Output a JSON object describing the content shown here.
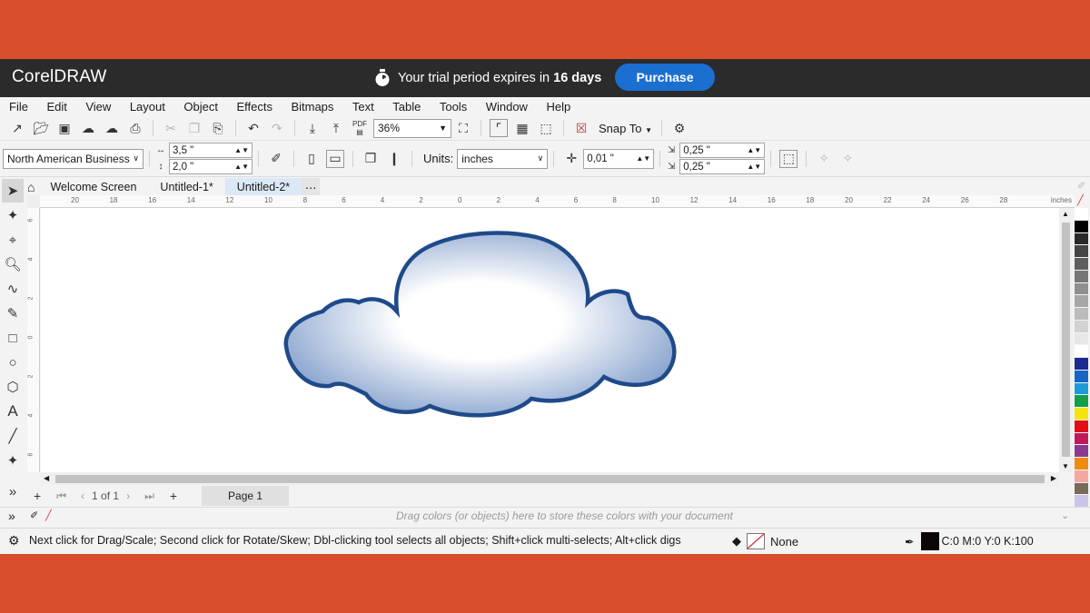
{
  "window": {
    "brand": "CorelDRAW",
    "trial_prefix": "Your trial period expires in ",
    "trial_days": "16 days",
    "purchase_label": "Purchase"
  },
  "menu": [
    "File",
    "Edit",
    "View",
    "Layout",
    "Object",
    "Effects",
    "Bitmaps",
    "Text",
    "Table",
    "Tools",
    "Window",
    "Help"
  ],
  "toolbar": {
    "zoom": "36%",
    "snap_label": "Snap To",
    "pdf_label": "PDF"
  },
  "property_bar": {
    "paper_size": "North American Business",
    "width": "3,5 \"",
    "height": "2,0 \"",
    "units_label": "Units:",
    "units_value": "inches",
    "nudge": "0,01 \"",
    "dup_x": "0,25 \"",
    "dup_y": "0,25 \""
  },
  "doc_tabs": [
    "Welcome Screen",
    "Untitled-1*",
    "Untitled-2*"
  ],
  "ruler": {
    "h_ticks": [
      "20",
      "18",
      "16",
      "14",
      "12",
      "10",
      "8",
      "6",
      "4",
      "2",
      "0",
      "2",
      "4",
      "6",
      "8",
      "10",
      "12",
      "14",
      "16",
      "18",
      "20",
      "22",
      "24",
      "26",
      "28"
    ],
    "unit": "inches",
    "v_ticks": [
      "6",
      "4",
      "2",
      "0",
      "2",
      "4",
      "6"
    ]
  },
  "page_nav": {
    "current": "1",
    "of_label": "of",
    "total": "1",
    "page_tab": "Page 1"
  },
  "docker_hint": "Drag colors (or objects) here to store these colors with your document",
  "status": {
    "message": "Next click for Drag/Scale; Second click for Rotate/Skew; Dbl-clicking tool selects all objects; Shift+click multi-selects; Alt+click digs",
    "fill_label": "None",
    "outline_value": "C:0 M:0 Y:0 K:100"
  },
  "colors": {
    "background": "#d94f2b",
    "titlebar": "#2b2b2b",
    "accent": "#1b6fd1",
    "cloud_outline": "#1f4a8a",
    "cloud_fill_light": "#ffffff",
    "cloud_fill_dark": "#7c9ac9"
  },
  "palette": [
    "#ffffff",
    "#000000",
    "#2a2a2a",
    "#454545",
    "#5e5e5e",
    "#777777",
    "#8f8f8f",
    "#a7a7a7",
    "#bcbcbc",
    "#d2d2d2",
    "#e7e7e7",
    "#ffffff",
    "#1c2b8f",
    "#1466c7",
    "#1c9bd6",
    "#12a04a",
    "#f5e50c",
    "#e30e18",
    "#c2175b",
    "#8b3a8f",
    "#ef8a12",
    "#f5a8a0",
    "#7a6a58",
    "#c9c4e8"
  ]
}
